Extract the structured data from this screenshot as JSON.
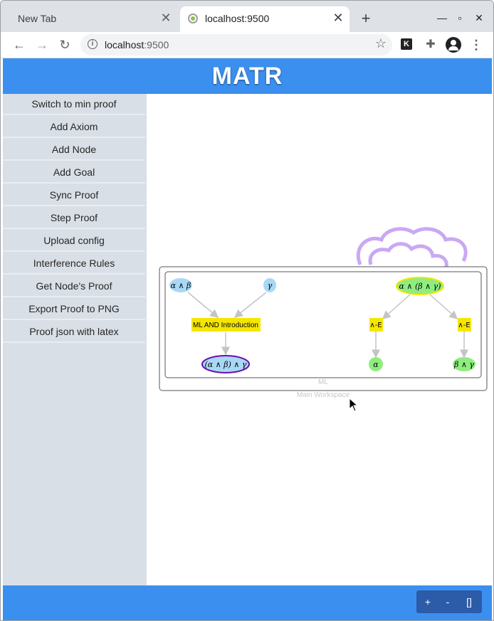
{
  "browser": {
    "tabs": [
      {
        "title": "New Tab",
        "active": false
      },
      {
        "title": "localhost:9500",
        "active": true
      }
    ],
    "url_host": "localhost",
    "url_port": ":9500",
    "icons": {
      "new_tab": "plus-icon",
      "minimize": "minimize-icon",
      "maximize": "maximize-icon",
      "close": "close-icon",
      "back": "back-arrow-icon",
      "forward": "forward-arrow-icon",
      "reload": "reload-icon",
      "bookmark": "star-icon",
      "extensions": "puzzle-icon",
      "profile": "profile-icon",
      "menu": "kebab-menu-icon"
    },
    "extension_k_label": "K"
  },
  "app": {
    "title": "MATR",
    "accent_color": "#3b8fef",
    "sidebar": {
      "buttons": [
        "Switch to min proof",
        "Add Axiom",
        "Add Node",
        "Add Goal",
        "Sync Proof",
        "Step Proof",
        "Upload config",
        "Interference Rules",
        "Get Node's Proof",
        "Export Proof to PNG",
        "Proof json with latex"
      ]
    },
    "graph": {
      "workspace_label_line1": "ML",
      "workspace_label_line2": "Main Workspace",
      "nodes": {
        "ab": "α ∧ β",
        "gamma": "γ",
        "ml_intro": "ML AND Introduction",
        "result": "(α ∧ β) ∧ γ",
        "premise": "α ∧ (β ∧ γ)",
        "and_e_left": "∧-E",
        "and_e_right": "∧-E",
        "alpha": "α",
        "bg": "β ∧ γ"
      },
      "node_colors": {
        "axiom": "#a9d8f5",
        "rule": "#f5e600",
        "goal_fill": "#a9d8f5",
        "goal_border": "#6a0dad",
        "derived": "#8eed7e",
        "premise_border": "#f5e600"
      }
    },
    "zoom_controls": [
      "+",
      "-",
      "[]"
    ]
  }
}
